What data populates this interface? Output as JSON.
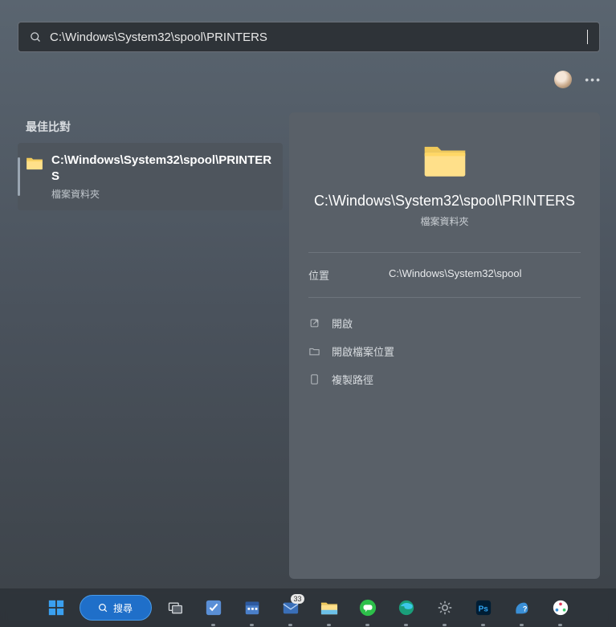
{
  "search": {
    "query": "C:\\Windows\\System32\\spool\\PRINTERS"
  },
  "left": {
    "section_header": "最佳比對",
    "result": {
      "title": "C:\\Windows\\System32\\spool\\PRINTERS",
      "subtitle": "檔案資料夾"
    }
  },
  "detail": {
    "title": "C:\\Windows\\System32\\spool\\PRINTERS",
    "subtitle": "檔案資料夾",
    "location_label": "位置",
    "location_value": "C:\\Windows\\System32\\spool",
    "actions": {
      "open": "開啟",
      "open_location": "開啟檔案位置",
      "copy_path": "複製路徑"
    }
  },
  "taskbar": {
    "search_label": "搜尋",
    "mail_badge": "33"
  }
}
